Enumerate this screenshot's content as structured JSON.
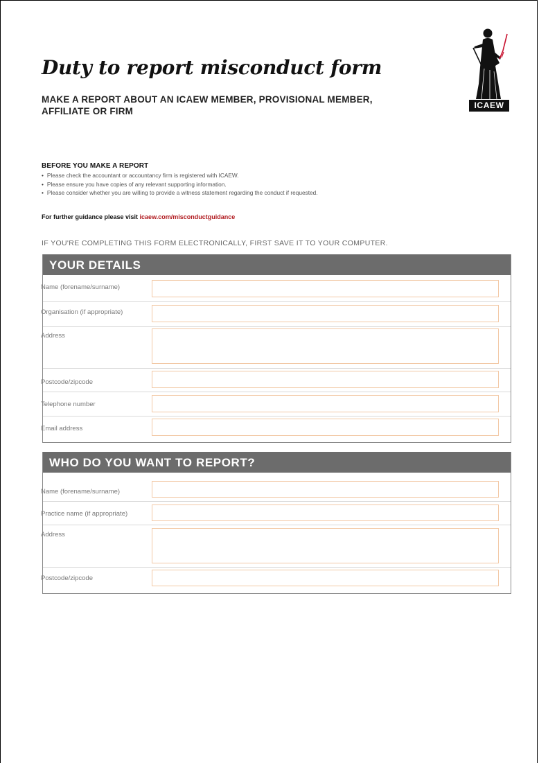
{
  "title": "Duty to report misconduct form",
  "subtitle": "MAKE A REPORT ABOUT AN ICAEW MEMBER, PROVISIONAL MEMBER, AFFILIATE OR FIRM",
  "logo": {
    "text": "ICAEW",
    "accent_color": "#c8102e"
  },
  "before": {
    "heading": "BEFORE YOU MAKE A REPORT",
    "bullets": [
      "Please check the accountant or accountancy firm is registered with ICAEW.",
      "Please ensure you have copies of any relevant supporting information.",
      "Please consider whether you are willing to provide a witness statement regarding the conduct if requested."
    ]
  },
  "guidance": {
    "text": "For further guidance please visit ",
    "link": "icaew.com/misconductguidance"
  },
  "notice": "IF YOU'RE COMPLETING THIS FORM ELECTRONICALLY, FIRST SAVE IT TO YOUR COMPUTER.",
  "your_details": {
    "heading": "YOUR DETAILS",
    "fields": [
      {
        "label": "Name (forename/surname)",
        "value": ""
      },
      {
        "label": "Organisation (if appropriate)",
        "value": ""
      },
      {
        "label": "Address",
        "value": ""
      },
      {
        "label": "Postcode/zipcode",
        "value": ""
      },
      {
        "label": "Telephone number",
        "value": ""
      },
      {
        "label": "Email address",
        "value": ""
      }
    ]
  },
  "report": {
    "heading": "WHO DO YOU WANT TO REPORT?",
    "fields": [
      {
        "label": "Name (forename/surname)",
        "value": ""
      },
      {
        "label": "Practice name (if appropriate)",
        "value": ""
      },
      {
        "label": "Address",
        "value": ""
      },
      {
        "label": "Postcode/zipcode",
        "value": ""
      }
    ]
  },
  "colors": {
    "section_header": "#6c6c6c",
    "field_border": "#f2c8a4",
    "link": "#b0191e"
  }
}
